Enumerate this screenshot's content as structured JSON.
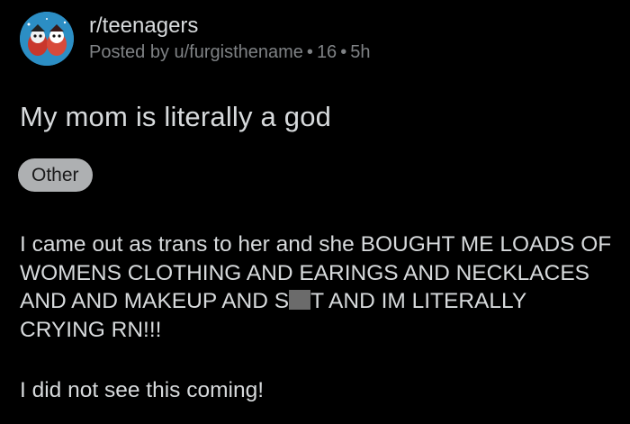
{
  "post": {
    "subreddit": "r/teenagers",
    "posted_by_prefix": "Posted by u/furgisthename",
    "points": "16",
    "age": "5h",
    "title": "My mom is literally a god",
    "flair": "Other",
    "body_part1": "I came out as trans to her and she BOUGHT ME LOADS OF WOMENS CLOTHING AND EARINGS AND NECKLACES AND AND MAKEUP AND S",
    "body_part2": "T AND IM LITERALLY CRYING RN!!!",
    "body_paragraph2": "I did not see this coming!"
  },
  "icons": {
    "avatar": "subreddit-avatar-icon",
    "censor": "censor-block"
  },
  "colors": {
    "background": "#000000",
    "text": "#d7dadc",
    "meta_text": "#7f8285",
    "flair_bg": "#aeb0b2",
    "avatar_bg": "#2c8ec4"
  }
}
